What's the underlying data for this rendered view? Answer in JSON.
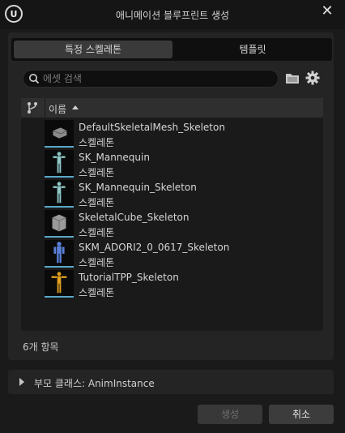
{
  "window": {
    "title": "애니메이션 블루프린트 생성",
    "close_symbol": "✕",
    "logo_text": "U"
  },
  "tabs": [
    {
      "label": "특정 스켈레톤",
      "active": true
    },
    {
      "label": "템플릿",
      "active": false
    }
  ],
  "search": {
    "placeholder": "에셋 검색",
    "value": ""
  },
  "toolbar": {
    "folder_icon": "folder-icon",
    "settings_icon": "gear-icon"
  },
  "list": {
    "header": {
      "column": "이름",
      "sort": "ascending"
    },
    "rows": [
      {
        "name": "DefaultSkeletalMesh_Skeleton",
        "type": "스켈레톤",
        "thumbnail": "mesh-thumbnail"
      },
      {
        "name": "SK_Mannequin",
        "type": "스켈레톤",
        "thumbnail": "mannequin-thumbnail"
      },
      {
        "name": "SK_Mannequin_Skeleton",
        "type": "스켈레톤",
        "thumbnail": "mannequin-thumbnail"
      },
      {
        "name": "SkeletalCube_Skeleton",
        "type": "스켈레톤",
        "thumbnail": "cube-thumbnail"
      },
      {
        "name": "SKM_ADORI2_0_0617_Skeleton",
        "type": "스켈레톤",
        "thumbnail": "character-thumbnail"
      },
      {
        "name": "TutorialTPP_Skeleton",
        "type": "스켈레톤",
        "thumbnail": "character-thumbnail"
      }
    ]
  },
  "item_count": "6개 항목",
  "parent_class": {
    "label": "부모 클래스: AnimInstance",
    "expanded": false
  },
  "buttons": {
    "create": "생성",
    "cancel": "취소"
  },
  "colors": {
    "background": "#1a1a1a",
    "panel": "#242424",
    "thumbnail_accent": "#5aa8c8"
  }
}
